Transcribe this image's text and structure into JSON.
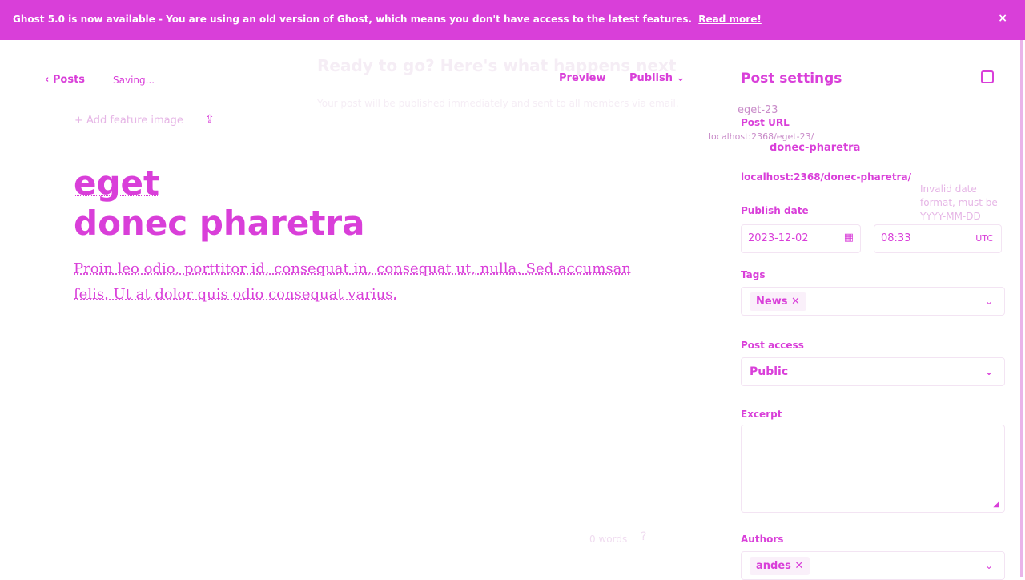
{
  "banner": {
    "message": "Ghost 5.0 is now available - You are using an old version of Ghost, which means you don't have access to the latest features.",
    "link": "Read more!",
    "close": "×"
  },
  "editor": {
    "back_label": "Posts",
    "status": "Saving...",
    "preview_label": "Preview",
    "publish_label": "Publish",
    "feature_image_label": "+ Add feature image",
    "title_line1": "eget",
    "title_line2": "donec pharetra",
    "body": [
      "Proin leo odio, porttitor id, consequat in, consequat ut, nulla. Sed accumsan",
      "felis. Ut at dolor quis odio consequat varius."
    ],
    "word_count": "0 words",
    "ghost_heading": "Ready to go? Here's what happens next",
    "ghost_para": "Your post will be published immediately and sent to all members via email."
  },
  "sidebar": {
    "title": "Post settings",
    "post_url": {
      "label": "Post URL",
      "value": "donec-pharetra",
      "hint": "localhost:2368/donec-pharetra/",
      "ghost_value": "eget-23",
      "ghost_hint": "localhost:2368/eget-23/"
    },
    "publish_date": {
      "label": "Publish date",
      "date": "2023-12-02",
      "time": "08:33",
      "tz": "UTC",
      "error": "Invalid date format, must be YYYY-MM-DD"
    },
    "tags": {
      "label": "Tags",
      "items": [
        "News"
      ]
    },
    "post_access": {
      "label": "Post access",
      "value": "Public"
    },
    "excerpt": {
      "label": "Excerpt"
    },
    "authors": {
      "label": "Authors",
      "items": [
        "andes"
      ]
    }
  }
}
